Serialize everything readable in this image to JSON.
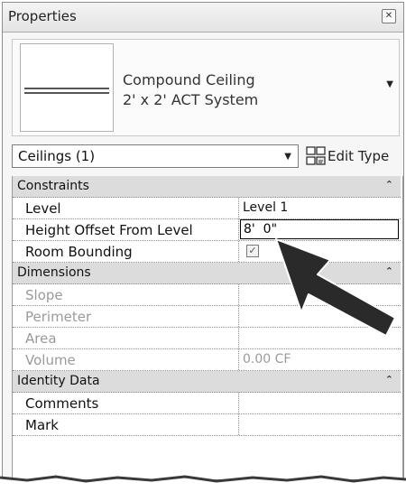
{
  "panel": {
    "title": "Properties",
    "close_glyph": "✕"
  },
  "type_preview": {
    "family": "Compound Ceiling",
    "type": "2' x 2' ACT System",
    "dropdown_glyph": "▼"
  },
  "selector": {
    "label": "Ceilings (1)",
    "dropdown_glyph": "▼",
    "edit_type_label": "Edit Type",
    "edit_type_icon": "edit-type-icon"
  },
  "groups": {
    "constraints": {
      "label": "Constraints",
      "collapse_glyph": "⌃"
    },
    "dimensions": {
      "label": "Dimensions",
      "collapse_glyph": "⌃"
    },
    "identity": {
      "label": "Identity Data",
      "collapse_glyph": "⌃"
    }
  },
  "params": {
    "level": {
      "name": "Level",
      "value": "Level 1"
    },
    "height_offset": {
      "name": "Height Offset From Level",
      "value": "8'  0\""
    },
    "room_bounding": {
      "name": "Room Bounding",
      "checked": true,
      "check_glyph": "✓"
    },
    "slope": {
      "name": "Slope",
      "value": ""
    },
    "perimeter": {
      "name": "Perimeter",
      "value": ""
    },
    "area": {
      "name": "Area",
      "value": ""
    },
    "volume": {
      "name": "Volume",
      "value": "0.00 CF"
    },
    "comments": {
      "name": "Comments",
      "value": ""
    },
    "mark": {
      "name": "Mark",
      "value": ""
    }
  },
  "annotation": {
    "arrow_icon": "pointer-arrow-icon",
    "arrow_color": "#2a2a2a"
  }
}
